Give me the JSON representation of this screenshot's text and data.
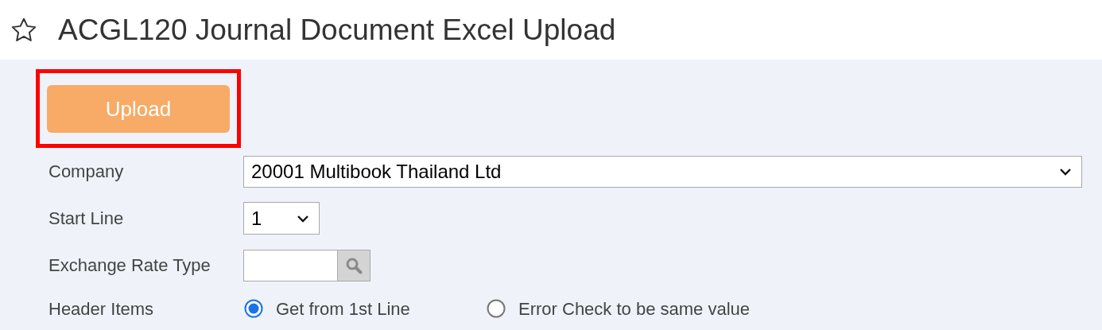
{
  "page": {
    "title": "ACGL120 Journal Document Excel Upload",
    "favorite": false
  },
  "upload_button": {
    "label": "Upload",
    "highlighted": true
  },
  "fields": [
    {
      "kind": "select",
      "label": "Company",
      "value": "20001 Multibook Thailand Ltd"
    },
    {
      "kind": "select_small",
      "label": "Start Line",
      "value": "1"
    },
    {
      "kind": "lookup",
      "label": "Exchange Rate Type"
    },
    {
      "kind": "radios",
      "label": "Header Items",
      "options": [
        {
          "label": "Get from 1st Line",
          "selected": true
        },
        {
          "label": "Error Check to be same value",
          "selected": false
        }
      ]
    }
  ]
}
